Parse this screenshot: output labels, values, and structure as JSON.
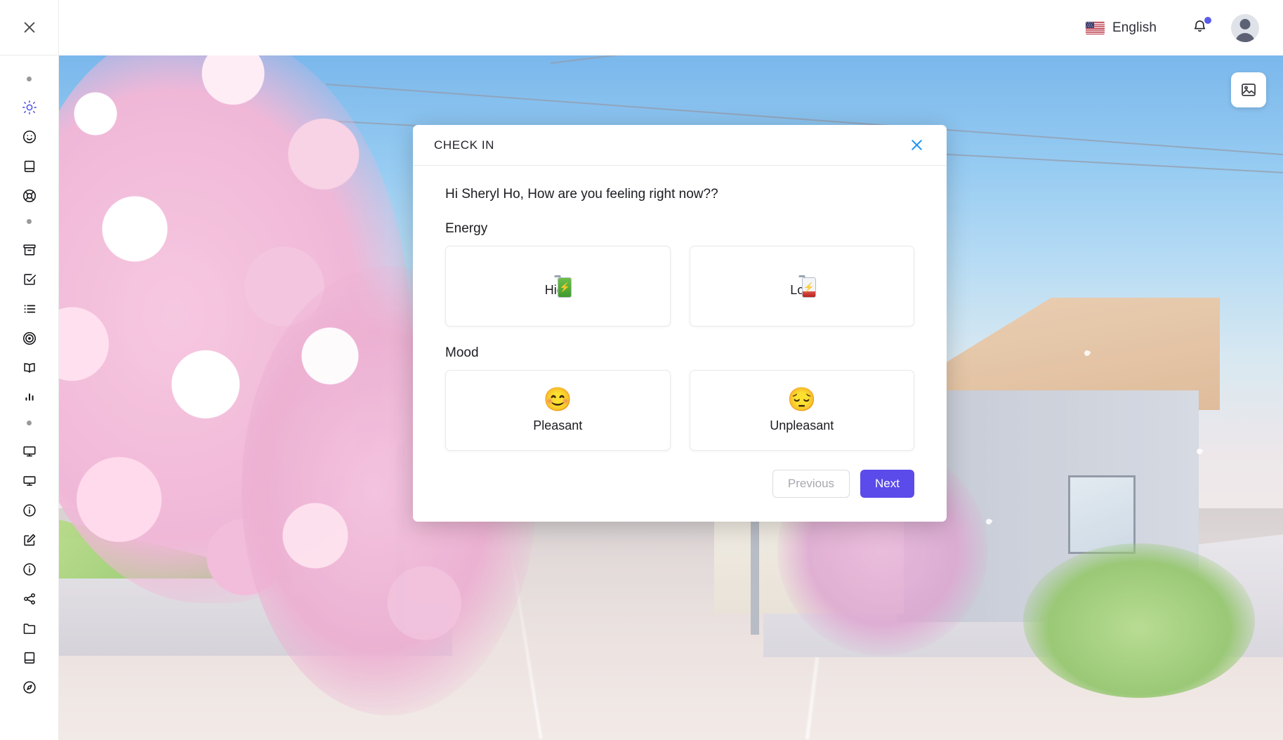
{
  "header": {
    "language": "English",
    "flag_icon": "us-flag-icon",
    "bell_icon": "bell-icon",
    "has_notification": true,
    "avatar_icon": "user-avatar-icon"
  },
  "sidebar": {
    "close_icon": "close-icon",
    "groups": [
      {
        "dot": true,
        "items": [
          {
            "icon": "sun-icon",
            "active": true
          },
          {
            "icon": "smiley-face-icon",
            "active": false
          },
          {
            "icon": "book-closed-icon",
            "active": false
          },
          {
            "icon": "lifebuoy-icon",
            "active": false
          }
        ]
      },
      {
        "dot": true,
        "items": [
          {
            "icon": "archive-box-icon",
            "active": false
          },
          {
            "icon": "check-square-icon",
            "active": false
          },
          {
            "icon": "list-icon",
            "active": false
          },
          {
            "icon": "target-icon",
            "active": false
          },
          {
            "icon": "open-book-icon",
            "active": false
          },
          {
            "icon": "bar-chart-icon",
            "active": false
          }
        ]
      },
      {
        "dot": true,
        "items": [
          {
            "icon": "monitor-icon",
            "active": false
          },
          {
            "icon": "monitor-alt-icon",
            "active": false
          },
          {
            "icon": "info-circle-icon",
            "active": false
          },
          {
            "icon": "edit-square-icon",
            "active": false
          },
          {
            "icon": "info-circle-alt-icon",
            "active": false
          },
          {
            "icon": "share-icon",
            "active": false
          },
          {
            "icon": "folder-icon",
            "active": false
          },
          {
            "icon": "book-closed-alt-icon",
            "active": false
          },
          {
            "icon": "compass-icon",
            "active": false
          }
        ]
      }
    ]
  },
  "stage": {
    "wallpaper_button_icon": "image-picker-icon"
  },
  "modal": {
    "title": "CHECK IN",
    "close_icon": "close-icon",
    "greeting": "Hi Sheryl Ho, How are you feeling right now??",
    "sections": [
      {
        "label": "Energy",
        "options": [
          {
            "label": "High",
            "icon": "battery-full-icon"
          },
          {
            "label": "Low",
            "icon": "battery-low-icon"
          }
        ]
      },
      {
        "label": "Mood",
        "options": [
          {
            "label": "Pleasant",
            "emoji": "😊",
            "icon": "smiling-face-icon"
          },
          {
            "label": "Unpleasant",
            "emoji": "😔",
            "icon": "pensive-face-icon"
          }
        ]
      }
    ],
    "buttons": {
      "previous": "Previous",
      "next": "Next"
    }
  },
  "colors": {
    "accent": "#5b4bea",
    "link": "#2196f3",
    "sidebar_active": "#5b5bea",
    "notification_dot": "#5b5bea"
  }
}
